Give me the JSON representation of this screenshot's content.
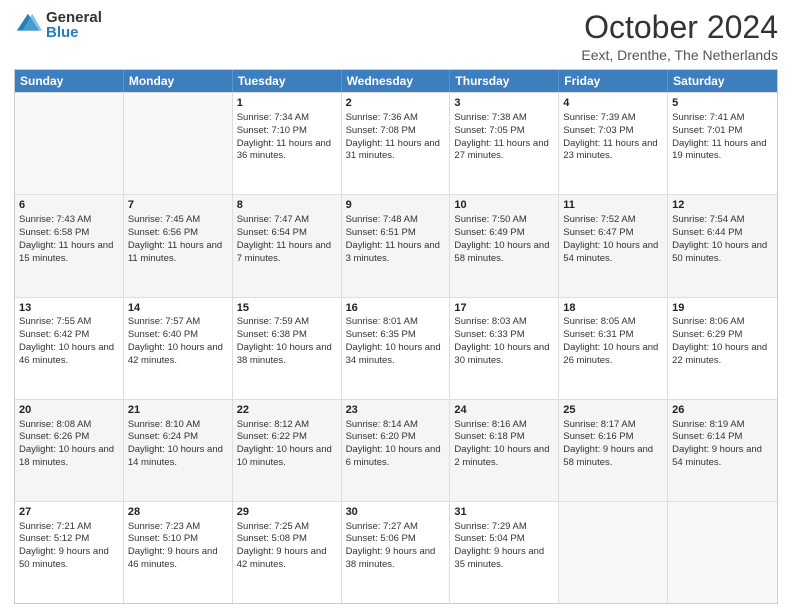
{
  "logo": {
    "general": "General",
    "blue": "Blue"
  },
  "title": "October 2024",
  "subtitle": "Eext, Drenthe, The Netherlands",
  "days": [
    "Sunday",
    "Monday",
    "Tuesday",
    "Wednesday",
    "Thursday",
    "Friday",
    "Saturday"
  ],
  "weeks": [
    [
      {
        "day": "",
        "content": ""
      },
      {
        "day": "",
        "content": ""
      },
      {
        "day": "1",
        "content": "Sunrise: 7:34 AM\nSunset: 7:10 PM\nDaylight: 11 hours and 36 minutes."
      },
      {
        "day": "2",
        "content": "Sunrise: 7:36 AM\nSunset: 7:08 PM\nDaylight: 11 hours and 31 minutes."
      },
      {
        "day": "3",
        "content": "Sunrise: 7:38 AM\nSunset: 7:05 PM\nDaylight: 11 hours and 27 minutes."
      },
      {
        "day": "4",
        "content": "Sunrise: 7:39 AM\nSunset: 7:03 PM\nDaylight: 11 hours and 23 minutes."
      },
      {
        "day": "5",
        "content": "Sunrise: 7:41 AM\nSunset: 7:01 PM\nDaylight: 11 hours and 19 minutes."
      }
    ],
    [
      {
        "day": "6",
        "content": "Sunrise: 7:43 AM\nSunset: 6:58 PM\nDaylight: 11 hours and 15 minutes."
      },
      {
        "day": "7",
        "content": "Sunrise: 7:45 AM\nSunset: 6:56 PM\nDaylight: 11 hours and 11 minutes."
      },
      {
        "day": "8",
        "content": "Sunrise: 7:47 AM\nSunset: 6:54 PM\nDaylight: 11 hours and 7 minutes."
      },
      {
        "day": "9",
        "content": "Sunrise: 7:48 AM\nSunset: 6:51 PM\nDaylight: 11 hours and 3 minutes."
      },
      {
        "day": "10",
        "content": "Sunrise: 7:50 AM\nSunset: 6:49 PM\nDaylight: 10 hours and 58 minutes."
      },
      {
        "day": "11",
        "content": "Sunrise: 7:52 AM\nSunset: 6:47 PM\nDaylight: 10 hours and 54 minutes."
      },
      {
        "day": "12",
        "content": "Sunrise: 7:54 AM\nSunset: 6:44 PM\nDaylight: 10 hours and 50 minutes."
      }
    ],
    [
      {
        "day": "13",
        "content": "Sunrise: 7:55 AM\nSunset: 6:42 PM\nDaylight: 10 hours and 46 minutes."
      },
      {
        "day": "14",
        "content": "Sunrise: 7:57 AM\nSunset: 6:40 PM\nDaylight: 10 hours and 42 minutes."
      },
      {
        "day": "15",
        "content": "Sunrise: 7:59 AM\nSunset: 6:38 PM\nDaylight: 10 hours and 38 minutes."
      },
      {
        "day": "16",
        "content": "Sunrise: 8:01 AM\nSunset: 6:35 PM\nDaylight: 10 hours and 34 minutes."
      },
      {
        "day": "17",
        "content": "Sunrise: 8:03 AM\nSunset: 6:33 PM\nDaylight: 10 hours and 30 minutes."
      },
      {
        "day": "18",
        "content": "Sunrise: 8:05 AM\nSunset: 6:31 PM\nDaylight: 10 hours and 26 minutes."
      },
      {
        "day": "19",
        "content": "Sunrise: 8:06 AM\nSunset: 6:29 PM\nDaylight: 10 hours and 22 minutes."
      }
    ],
    [
      {
        "day": "20",
        "content": "Sunrise: 8:08 AM\nSunset: 6:26 PM\nDaylight: 10 hours and 18 minutes."
      },
      {
        "day": "21",
        "content": "Sunrise: 8:10 AM\nSunset: 6:24 PM\nDaylight: 10 hours and 14 minutes."
      },
      {
        "day": "22",
        "content": "Sunrise: 8:12 AM\nSunset: 6:22 PM\nDaylight: 10 hours and 10 minutes."
      },
      {
        "day": "23",
        "content": "Sunrise: 8:14 AM\nSunset: 6:20 PM\nDaylight: 10 hours and 6 minutes."
      },
      {
        "day": "24",
        "content": "Sunrise: 8:16 AM\nSunset: 6:18 PM\nDaylight: 10 hours and 2 minutes."
      },
      {
        "day": "25",
        "content": "Sunrise: 8:17 AM\nSunset: 6:16 PM\nDaylight: 9 hours and 58 minutes."
      },
      {
        "day": "26",
        "content": "Sunrise: 8:19 AM\nSunset: 6:14 PM\nDaylight: 9 hours and 54 minutes."
      }
    ],
    [
      {
        "day": "27",
        "content": "Sunrise: 7:21 AM\nSunset: 5:12 PM\nDaylight: 9 hours and 50 minutes."
      },
      {
        "day": "28",
        "content": "Sunrise: 7:23 AM\nSunset: 5:10 PM\nDaylight: 9 hours and 46 minutes."
      },
      {
        "day": "29",
        "content": "Sunrise: 7:25 AM\nSunset: 5:08 PM\nDaylight: 9 hours and 42 minutes."
      },
      {
        "day": "30",
        "content": "Sunrise: 7:27 AM\nSunset: 5:06 PM\nDaylight: 9 hours and 38 minutes."
      },
      {
        "day": "31",
        "content": "Sunrise: 7:29 AM\nSunset: 5:04 PM\nDaylight: 9 hours and 35 minutes."
      },
      {
        "day": "",
        "content": ""
      },
      {
        "day": "",
        "content": ""
      }
    ]
  ]
}
